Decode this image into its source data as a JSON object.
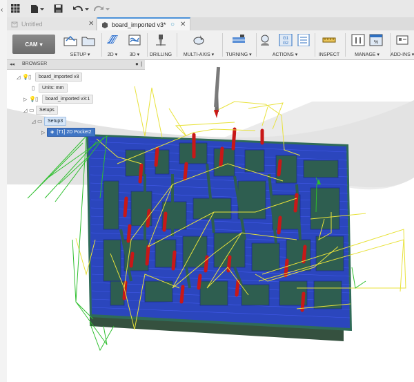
{
  "left_strip": {
    "collapse_glyph": "‹"
  },
  "quick_access": {
    "icons": [
      "grid-icon",
      "file-icon",
      "save-icon",
      "undo-icon",
      "redo-icon"
    ]
  },
  "tabs": [
    {
      "label": "Untitled",
      "active": false
    },
    {
      "label": "board_imported v3*",
      "active": true
    }
  ],
  "toolbar": {
    "workspace": "CAM",
    "workspace_arrow": "▾",
    "groups": [
      {
        "label": "SETUP ▾"
      },
      {
        "label": "2D ▾"
      },
      {
        "label": "3D ▾"
      },
      {
        "label": "DRILLING"
      },
      {
        "label": "MULTI-AXIS ▾"
      },
      {
        "label": "TURNING ▾"
      },
      {
        "label": "ACTIONS ▾"
      },
      {
        "label": "INSPECT"
      },
      {
        "label": "MANAGE ▾"
      },
      {
        "label": "ADD-INS ▾"
      }
    ]
  },
  "browser": {
    "title": "BROWSER",
    "collapse_glyph": "◂◂",
    "items": [
      {
        "label": "board_imported v3"
      },
      {
        "label": "Units: mm"
      },
      {
        "label": "board_imported v3:1"
      },
      {
        "label": "Setups"
      },
      {
        "label": "Setup3"
      },
      {
        "label": "[T1] 2D Pocket2"
      }
    ]
  },
  "colors": {
    "toolpath": "#1a35d6",
    "rapid": "#e6e23a",
    "lead": "#2fbf2f",
    "plunge": "#cc1e1e",
    "stock": "#2e4d3e"
  }
}
